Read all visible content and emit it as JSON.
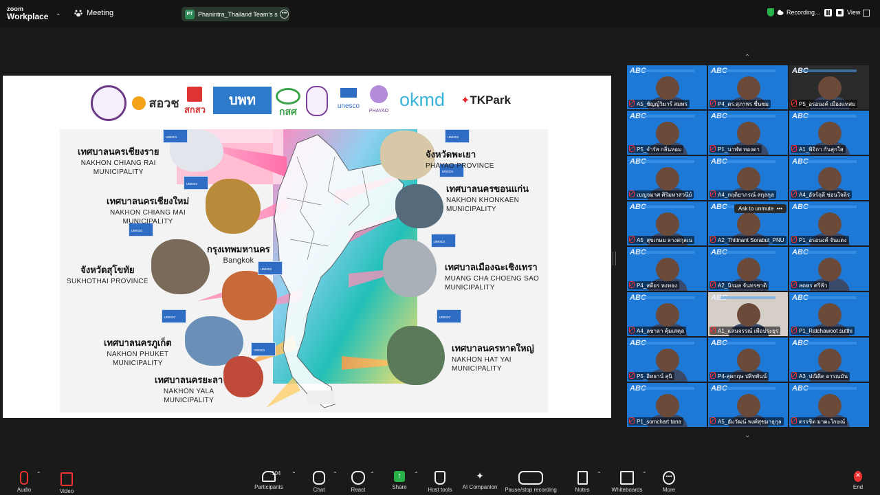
{
  "app": {
    "logo_line1": "zoom",
    "logo_line2": "Workplace",
    "meeting_label": "Meeting"
  },
  "share": {
    "badge": "PT",
    "label": "Phanintra_Thailand Team's scree"
  },
  "recording": {
    "label": "Recording..."
  },
  "view_label": "View",
  "slide": {
    "logos": [
      "สอวช",
      "สกสว",
      "บพท",
      "กสศ",
      "unesco",
      "PHAYAO",
      "okmd",
      "TKPark"
    ],
    "cities": [
      {
        "thai": "เทศบาลนครเชียงราย",
        "eng": [
          "NAKHON CHIANG RAI",
          "MUNICIPALITY"
        ]
      },
      {
        "thai": "เทศบาลนครเชียงใหม่",
        "eng": [
          "NAKHON CHIANG MAI",
          "MUNICIPALITY"
        ]
      },
      {
        "thai": "จังหวัดสุโขทัย",
        "eng": [
          "SUKHOTHAI PROVINCE"
        ]
      },
      {
        "thai": "กรุงเทพมหานคร",
        "eng": [
          "Bangkok"
        ]
      },
      {
        "thai": "เทศบาลนครภูเก็ต",
        "eng": [
          "NAKHON PHUKET",
          "MUNICIPALITY"
        ]
      },
      {
        "thai": "เทศบาลนครยะลา",
        "eng": [
          "NAKHON YALA",
          "MUNICIPALITY"
        ]
      },
      {
        "thai": "จังหวัดพะเยา",
        "eng": [
          "PHAYAO PROVINCE"
        ]
      },
      {
        "thai": "เทศบาลนครขอนแก่น",
        "eng": [
          "NAKHON KHONKAEN",
          "MUNICIPALITY"
        ]
      },
      {
        "thai": "เทศบาลเมืองฉะเชิงเทรา",
        "eng": [
          "MUANG CHA CHOENG SAO",
          "MUNICIPALITY"
        ]
      },
      {
        "thai": "เทศบาลนครหาดใหญ่",
        "eng": [
          "NAKHON HAT YAI",
          "MUNICIPALITY"
        ]
      }
    ]
  },
  "participants": [
    "A5_ชัญญ์วิมาร์ สมพร",
    "P4_ดร.สุภาพร ชื่นชม",
    "P5_อรอนงค์ เมืองแทสม",
    "P5_จำรัส กลิ่นหอม",
    "P1_นาฬพ ทองดา",
    "A1_พิจิกา กันสุกใส",
    "เบญจมาศ ศิริมหาสวนีย์",
    "A4_กฤติยาภรณ์ สกุลกุล",
    "A4_อัจร์ฤดี ช่อนใจดิร",
    "A5_สุขเกษม ลางสกุลเน",
    "A2_Thitinant Sorabut_PNU",
    "P1_อรอนงค์ จันแดง",
    "P4_สดีอร หงทอง",
    "A2_นิรมล จันทรชาติ",
    "ลดพร ศรีฟ้า",
    "A4_ลชาลา คุ้มเสคุล",
    "A1_แสนจรรณ์ เพือประยุร",
    "P1_Ratchawoot sutthi",
    "P5_อิทธาน์ สุนิ",
    "P4-สุดกฤษ ปลิทพันน์",
    "A3_ปณิดิต อารณมัน",
    "P1_somchart tana",
    "A5_อัมวัฒน์ พงศ์สุชมาธุกุล",
    "ดรรชิต มาตะใกษณ์"
  ],
  "ask_to_unmute": "Ask to unmute",
  "toolbar": {
    "audio": "Audio",
    "video": "Video",
    "participants": "Participants",
    "participants_count": "104",
    "chat": "Chat",
    "react": "React",
    "share": "Share",
    "host_tools": "Host tools",
    "ai": "AI Companion",
    "record": "Pause/stop recording",
    "notes": "Notes",
    "whiteboards": "Whiteboards",
    "more": "More",
    "end": "End"
  },
  "colors": {
    "share_green": "#27b24a",
    "end_red": "#e33333",
    "tile_blue": "#1e78d6"
  }
}
